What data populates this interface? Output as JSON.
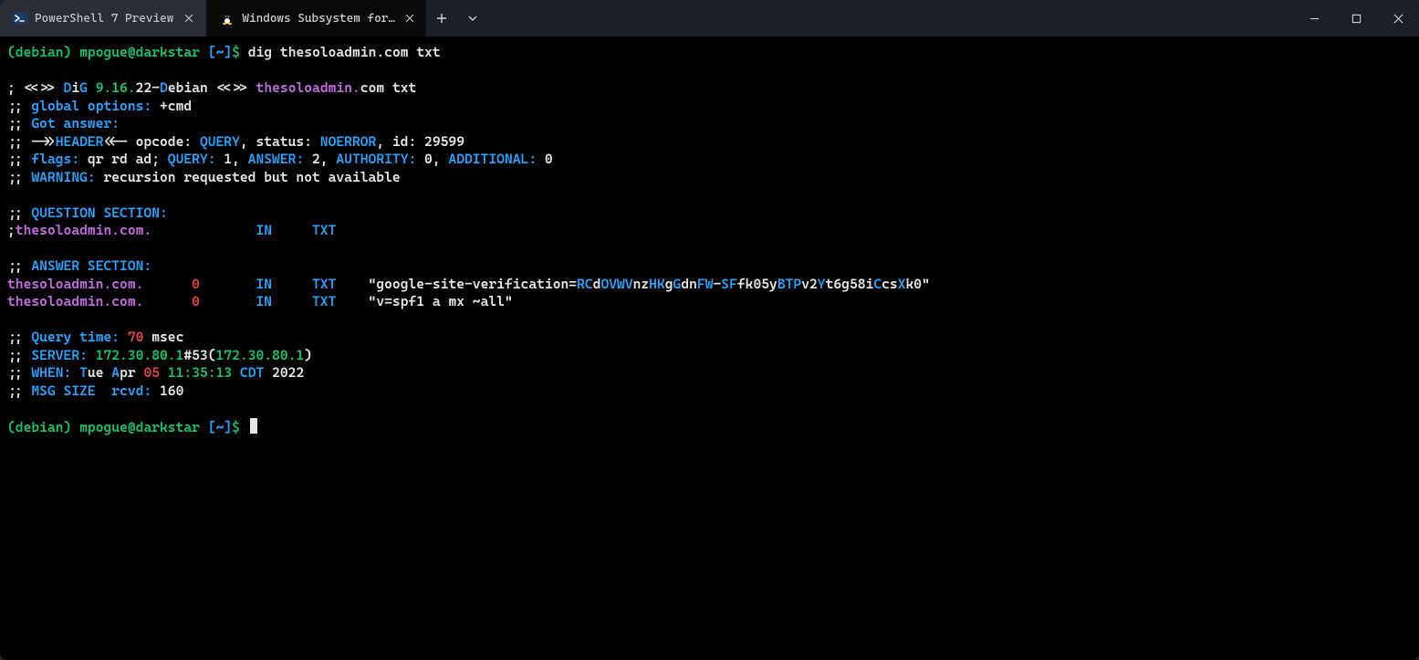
{
  "tabs": [
    {
      "label": "PowerShell 7 Preview",
      "icon": "powershell",
      "active": false
    },
    {
      "label": "Windows Subsystem for Linux P",
      "icon": "tux",
      "active": true
    }
  ],
  "prompt": {
    "distro_open": "(",
    "distro": "debian",
    "distro_close": ")",
    "userhost": "mpogue@darkstar",
    "path_open": "[",
    "path": "~",
    "path_close": "]",
    "sigil": "$"
  },
  "command": "dig thesoloadmin.com txt",
  "dig": {
    "banner_pre": "; <<>> ",
    "banner_D": "D",
    "banner_i": "i",
    "banner_G": "G",
    "banner_sp": " ",
    "ver_910": "9.16.",
    "ver_22": "22",
    "ver_dash": "-",
    "ver_D2": "D",
    "ver_ebian": "ebian",
    "banner_mid": " <<>> ",
    "banner_host1": "thesoloadmin.",
    "banner_host2": "com",
    "banner_tail": " txt",
    "opt_pre": ";; ",
    "opt_lbl": "global options:",
    "opt_val": " +cmd",
    "got_pre": ";; ",
    "got": "Got answer:",
    "hdr_pre": ";; ->>",
    "hdr_H": "HEADER",
    "hdr_post": "<<- opcode: ",
    "hdr_q": "QUERY",
    "hdr_c1": ", status: ",
    "hdr_noe": "NOERROR",
    "hdr_c2": ", id: ",
    "hdr_id": "29599",
    "flg_pre": ";; ",
    "flg_lbl": "flags:",
    "flg_vals": " qr rd ad; ",
    "flg_q": "QUERY:",
    "flg_qn": " 1, ",
    "flg_a": "ANSWER:",
    "flg_an": " 2, ",
    "flg_au": "AUTHORITY:",
    "flg_aun": " 0, ",
    "flg_ad": "ADDITIONAL:",
    "flg_adn": " 0",
    "warn_pre": ";; ",
    "warn_lbl": "WARNING:",
    "warn_txt": " recursion requested but not available",
    "qs_pre": ";; ",
    "qs_lbl": "QUESTION SECTION:",
    "qs_semi": ";",
    "qs_host": "thesoloadmin.com.",
    "qs_pad": "             ",
    "qs_in": "IN",
    "qs_pad2": "     ",
    "qs_txt": "TXT",
    "as_pre": ";; ",
    "as_lbl": "ANSWER SECTION:",
    "a1_host": "thesoloadmin.com.",
    "a1_pad1": "      ",
    "a1_ttl": "0",
    "a1_pad2": "       ",
    "a1_in": "IN",
    "a1_pad3": "     ",
    "a1_txt": "TXT",
    "a1_pad4": "    ",
    "a1_q1": "\"google-site-verification=",
    "a1_RC": "RC",
    "a1_d1": "d",
    "a1_OVWV": "OVWV",
    "a1_nz": "nz",
    "a1_HK": "HK",
    "a1_g": "g",
    "a1_G": "G",
    "a1_dn": "dn",
    "a1_FW": "FW",
    "a1_dash": "-",
    "a1_SF": "SF",
    "a1_fk05y": "fk05y",
    "a1_BTP": "BTP",
    "a1_v2": "v2",
    "a1_Y": "Y",
    "a1_t6g58i": "t6g58i",
    "a1_C": "C",
    "a1_cs": "cs",
    "a1_X": "X",
    "a1_k0": "k0",
    "a1_q2": "\"",
    "a2_host": "thesoloadmin.com.",
    "a2_pad1": "      ",
    "a2_ttl": "0",
    "a2_pad2": "       ",
    "a2_in": "IN",
    "a2_pad3": "     ",
    "a2_txt": "TXT",
    "a2_pad4": "    ",
    "a2_val": "\"v=spf1 a mx ~all\"",
    "qt_pre": ";; ",
    "qt_lbl": "Query time: ",
    "qt_val": "70",
    "qt_unit": " msec",
    "sv_pre": ";; ",
    "sv_lbl": "SERVER: ",
    "sv_ip": "172.30.80.1",
    "sv_hash": "#53(",
    "sv_ip2": "172.30.80.1",
    "sv_end": ")",
    "wh_pre": ";; ",
    "wh_lbl": "WHEN: ",
    "wh_T": "T",
    "wh_ue": "ue ",
    "wh_A": "A",
    "wh_pr": "pr ",
    "wh_05": "05",
    "wh_sp": " ",
    "wh_time": "11:35:13",
    "wh_tz": " CDT ",
    "wh_yr": "2022",
    "ms_pre": ";; ",
    "ms_lbl": "MSG SIZE  rcvd: ",
    "ms_val": "160"
  }
}
